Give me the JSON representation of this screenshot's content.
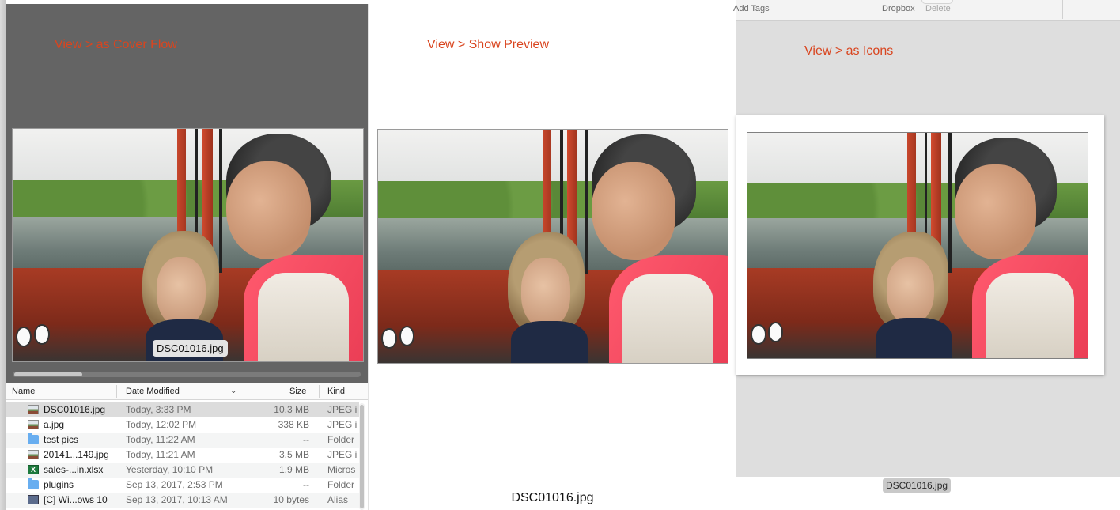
{
  "annotations": {
    "cover_flow": "View > as Cover Flow",
    "show_preview": "View > Show Preview",
    "as_icons": "View > as Icons"
  },
  "coverflow": {
    "caption": "DSC01016.jpg"
  },
  "list": {
    "headers": {
      "name": "Name",
      "date_modified": "Date Modified",
      "size": "Size",
      "kind": "Kind"
    },
    "rows": [
      {
        "name": "DSC01016.jpg",
        "date": "Today, 3:33 PM",
        "size": "10.3 MB",
        "kind": "JPEG i",
        "icon": "image-file-icon"
      },
      {
        "name": "a.jpg",
        "date": "Today, 12:02 PM",
        "size": "338 KB",
        "kind": "JPEG i",
        "icon": "image-file-icon"
      },
      {
        "name": "test pics",
        "date": "Today, 11:22 AM",
        "size": "--",
        "kind": "Folder",
        "icon": "folder-icon"
      },
      {
        "name": "20141...149.jpg",
        "date": "Today, 11:21 AM",
        "size": "3.5 MB",
        "kind": "JPEG i",
        "icon": "image-file-icon"
      },
      {
        "name": "sales-...in.xlsx",
        "date": "Yesterday, 10:10 PM",
        "size": "1.9 MB",
        "kind": "Micros",
        "icon": "excel-file-icon"
      },
      {
        "name": "plugins",
        "date": "Sep 13, 2017, 2:53 PM",
        "size": "--",
        "kind": "Folder",
        "icon": "folder-icon"
      },
      {
        "name": "[C] Wi...ows 10",
        "date": "Sep 13, 2017, 10:13 AM",
        "size": "10 bytes",
        "kind": "Alias",
        "icon": "alias-icon"
      }
    ]
  },
  "preview": {
    "filename": "DSC01016.jpg"
  },
  "icons_view": {
    "toolbar": {
      "add_tags": "Add Tags",
      "dropbox": "Dropbox",
      "delete": "Delete"
    },
    "label": "DSC01016.jpg"
  },
  "colors": {
    "annotation": "#d9451f",
    "coverflow_bg": "#646464",
    "folder": "#68aef0"
  }
}
